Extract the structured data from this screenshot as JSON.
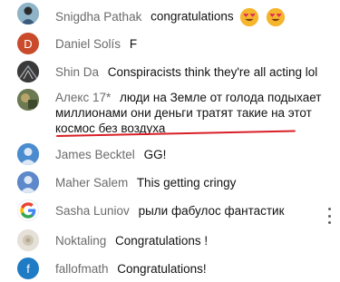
{
  "messages": [
    {
      "author": "Snigdha Pathak",
      "text": "congratulations",
      "avatar": {
        "icon": "photo-avatar",
        "bg": "#8fb4c8"
      }
    },
    {
      "author": "Daniel Solís",
      "text": "F",
      "avatar": {
        "letter": "D",
        "bg": "#c94b2c"
      }
    },
    {
      "author": "Shin Da",
      "text": "Conspiracists think they're all acting lol",
      "avatar": {
        "icon": "photo-avatar",
        "bg": "#3a3a3a"
      }
    },
    {
      "author": "Алекс 17*",
      "text": "люди на Земле от голода подыхает миллионами они деньги тратят такие на этот космос без воздуха",
      "avatar": {
        "icon": "photo-avatar",
        "bg": "#6c7a52"
      }
    },
    {
      "author": "James Becktel",
      "text": "GG!",
      "avatar": {
        "icon": "default-avatar",
        "bg": "#4b8ccf"
      }
    },
    {
      "author": "Maher Salem",
      "text": "This getting cringy",
      "avatar": {
        "icon": "default-avatar",
        "bg": "#5d88c9"
      }
    },
    {
      "author": "Sasha Luniov",
      "text": "рыли фабулос фантастик",
      "avatar": {
        "icon": "google-logo",
        "bg": "#ffffff"
      }
    },
    {
      "author": "Noktaling",
      "text": "Congratulations !",
      "avatar": {
        "icon": "photo-avatar",
        "bg": "#e6e1d8"
      }
    },
    {
      "author": "fallofmath",
      "text": "Congratulations!",
      "avatar": {
        "letter": "f",
        "bg": "#1f7bc4"
      }
    }
  ],
  "annotation": {
    "color": "#d81f26"
  },
  "menu": {
    "icon": "more-vertical-icon"
  }
}
